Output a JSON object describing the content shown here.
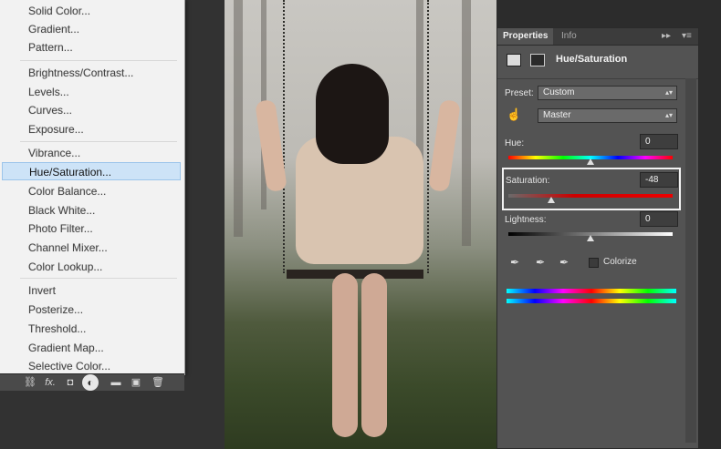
{
  "menu": {
    "items": [
      {
        "label": "Solid Color..."
      },
      {
        "label": "Gradient..."
      },
      {
        "label": "Pattern..."
      },
      {
        "label": "Brightness/Contrast..."
      },
      {
        "label": "Levels..."
      },
      {
        "label": "Curves..."
      },
      {
        "label": "Exposure..."
      },
      {
        "label": "Vibrance..."
      },
      {
        "label": "Hue/Saturation..."
      },
      {
        "label": "Color Balance..."
      },
      {
        "label": "Black  White..."
      },
      {
        "label": "Photo Filter..."
      },
      {
        "label": "Channel Mixer..."
      },
      {
        "label": "Color Lookup..."
      },
      {
        "label": "Invert"
      },
      {
        "label": "Posterize..."
      },
      {
        "label": "Threshold..."
      },
      {
        "label": "Gradient Map..."
      },
      {
        "label": "Selective Color..."
      }
    ],
    "selected": "Hue/Saturation..."
  },
  "layers_bar": {
    "link_icon": "link-icon",
    "fx_label": "fx.",
    "adjustment_icon": "adjustment-layer-icon",
    "folder_icon": "folder-icon",
    "new_layer_icon": "new-layer-icon",
    "trash_icon": "trash-icon"
  },
  "properties": {
    "tabs": [
      "Properties",
      "Info"
    ],
    "active_tab": "Properties",
    "title": "Hue/Saturation",
    "preset_label": "Preset:",
    "preset_value": "Custom",
    "channel_value": "Master",
    "hue_label": "Hue:",
    "hue_value": "0",
    "saturation_label": "Saturation:",
    "saturation_value": "-48",
    "lightness_label": "Lightness:",
    "lightness_value": "0",
    "colorize_label": "Colorize",
    "colorize_checked": false
  },
  "colors": {
    "menu_bg": "#f2f2f2",
    "menu_selected": "#cde3f7",
    "panel_bg": "#535353",
    "saturation_track": "#cc0000"
  }
}
